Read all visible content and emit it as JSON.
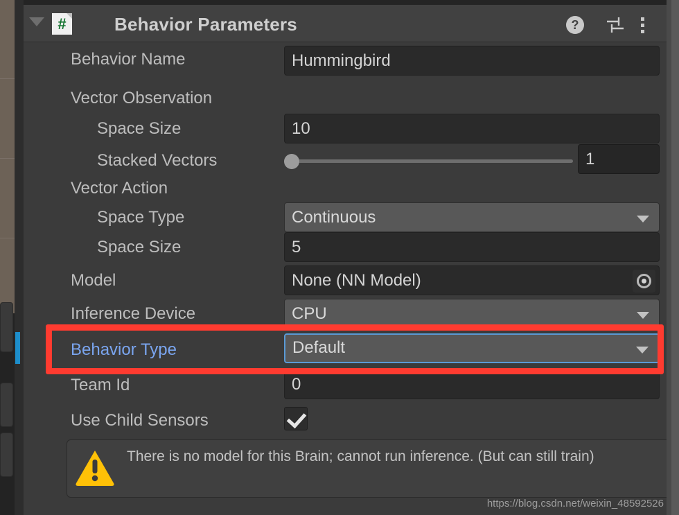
{
  "window": {
    "component_title": "Behavior Parameters",
    "script_icon": "csharp-script-icon",
    "foldout_icon": "foldout-triangle-icon",
    "help_icon_glyph": "?",
    "help_icon": "help-icon",
    "preset_icon": "preset-sliders-icon",
    "menu_icon": "kebab-menu-icon"
  },
  "rows": {
    "behavior_name": {
      "label": "Behavior Name",
      "value": "Hummingbird"
    },
    "vector_observation": {
      "label": "Vector Observation"
    },
    "obs_space_size": {
      "label": "Space Size",
      "value": "10"
    },
    "stacked_vectors": {
      "label": "Stacked Vectors",
      "value": "1",
      "slider_percent": 0
    },
    "vector_action": {
      "label": "Vector Action"
    },
    "action_space_type": {
      "label": "Space Type",
      "value": "Continuous"
    },
    "action_space_size": {
      "label": "Space Size",
      "value": "5"
    },
    "model": {
      "label": "Model",
      "value": "None (NN Model)",
      "picker_icon": "object-picker-icon"
    },
    "inference_device": {
      "label": "Inference Device",
      "value": "CPU"
    },
    "behavior_type": {
      "label": "Behavior Type",
      "value": "Default",
      "label_color": "#7aa5ef",
      "focus_border_color": "#5a9ad6"
    },
    "team_id": {
      "label": "Team Id",
      "value": "0"
    },
    "use_child_sensors": {
      "label": "Use Child Sensors",
      "checked": true
    }
  },
  "highlight": {
    "color": "#ff3b30",
    "target": "behavior-type-row"
  },
  "warning": {
    "icon": "warning-triangle-icon",
    "icon_color": "#ffc107",
    "text": "There is no model for this Brain; cannot run inference. (But can still train)"
  },
  "watermark": {
    "text": "https://blog.csdn.net/weixin_48592526"
  }
}
